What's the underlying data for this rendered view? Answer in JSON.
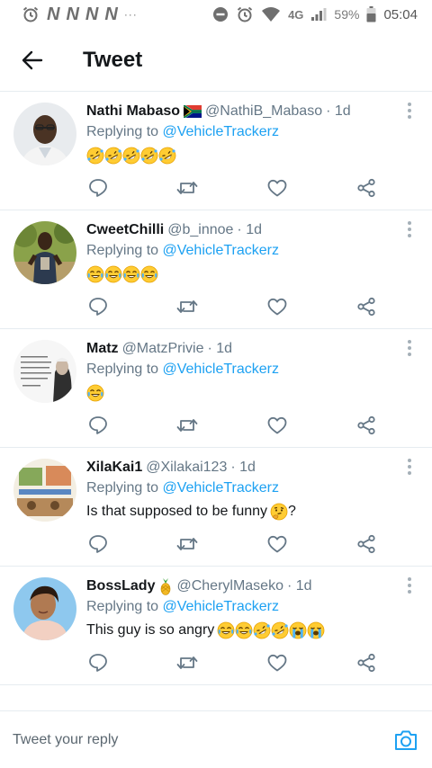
{
  "status_bar": {
    "network": "4G",
    "battery": "59%",
    "time": "05:04",
    "notification_glyph": "N"
  },
  "header": {
    "title": "Tweet"
  },
  "colors": {
    "accent": "#1da1f2",
    "muted": "#657786",
    "text": "#14171a",
    "divider": "#e6ecf0"
  },
  "tweets": [
    {
      "name": "Nathi Mabaso",
      "handle": "@NathiB_Mabaso",
      "time": "· 1d",
      "replying_prefix": "Replying to",
      "mention": "@VehicleTrackerz",
      "text": "",
      "emojis": [
        "rofl",
        "rofl",
        "rofl",
        "rofl",
        "rofl"
      ],
      "badge": "south-africa-flag"
    },
    {
      "name": "CweetChilli",
      "handle": "@b_innoe",
      "time": "· 1d",
      "replying_prefix": "Replying to",
      "mention": "@VehicleTrackerz",
      "text": "",
      "emojis": [
        "joy",
        "joy",
        "joy",
        "joy"
      ]
    },
    {
      "name": "Matz",
      "handle": "@MatzPrivie",
      "time": "· 1d",
      "replying_prefix": "Replying to",
      "mention": "@VehicleTrackerz",
      "text": "",
      "emojis": [
        "joy"
      ]
    },
    {
      "name": "XilaKai1",
      "handle": "@Xilakai123",
      "time": "· 1d",
      "replying_prefix": "Replying to",
      "mention": "@VehicleTrackerz",
      "text": "Is that supposed to be funny",
      "text_suffix": "?",
      "emojis": [
        "thinking"
      ]
    },
    {
      "name": "BossLady",
      "handle": "@CherylMaseko",
      "time": "· 1d",
      "replying_prefix": "Replying to",
      "mention": "@VehicleTrackerz",
      "text": "This guy is so angry",
      "emojis": [
        "joy",
        "joy",
        "rofl",
        "rofl",
        "sob",
        "sob"
      ],
      "badge": "pineapple"
    }
  ],
  "composer": {
    "placeholder": "Tweet your reply"
  }
}
